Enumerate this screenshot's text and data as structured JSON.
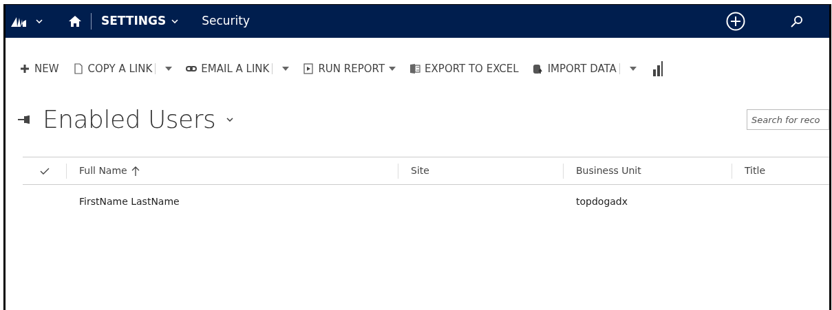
{
  "nav": {
    "area": "SETTINGS",
    "page": "Security"
  },
  "toolbar": [
    {
      "label": "NEW",
      "kind": "button"
    },
    {
      "label": "COPY A LINK",
      "kind": "split"
    },
    {
      "label": "EMAIL A LINK",
      "kind": "split"
    },
    {
      "label": "RUN REPORT",
      "kind": "dropdown"
    },
    {
      "label": "EXPORT TO EXCEL",
      "kind": "button"
    },
    {
      "label": "IMPORT DATA",
      "kind": "split"
    }
  ],
  "view": {
    "title": "Enabled Users"
  },
  "search": {
    "placeholder": "Search for reco"
  },
  "table": {
    "columns": [
      {
        "label": "Full Name",
        "sorted": true
      },
      {
        "label": "Site",
        "sorted": false
      },
      {
        "label": "Business Unit",
        "sorted": false
      },
      {
        "label": "Title",
        "sorted": false
      }
    ],
    "rows": [
      {
        "cells": [
          "FirstName LastName",
          "",
          "topdogadx",
          ""
        ]
      }
    ]
  }
}
